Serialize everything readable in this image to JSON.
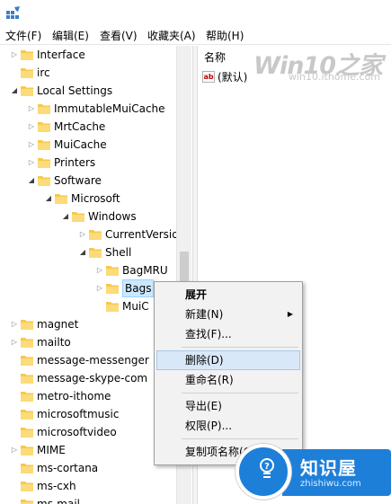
{
  "menubar": {
    "items": [
      "文件(F)",
      "编辑(E)",
      "查看(V)",
      "收藏夹(A)",
      "帮助(H)"
    ]
  },
  "tree": {
    "rows": [
      {
        "label": "Interface",
        "expander": "collapsed"
      },
      {
        "label": "irc",
        "expander": "none"
      },
      {
        "label": "Local Settings",
        "expander": "expanded"
      },
      {
        "label": "ImmutableMuiCache",
        "expander": "collapsed"
      },
      {
        "label": "MrtCache",
        "expander": "collapsed"
      },
      {
        "label": "MuiCache",
        "expander": "collapsed"
      },
      {
        "label": "Printers",
        "expander": "collapsed"
      },
      {
        "label": "Software",
        "expander": "expanded"
      },
      {
        "label": "Microsoft",
        "expander": "expanded"
      },
      {
        "label": "Windows",
        "expander": "expanded"
      },
      {
        "label": "CurrentVersio",
        "expander": "collapsed"
      },
      {
        "label": "Shell",
        "expander": "expanded"
      },
      {
        "label": "BagMRU",
        "expander": "collapsed"
      },
      {
        "label": "Bags",
        "expander": "collapsed",
        "selected": true
      },
      {
        "label": "MuiC",
        "expander": "none"
      },
      {
        "label": "magnet",
        "expander": "collapsed"
      },
      {
        "label": "mailto",
        "expander": "collapsed"
      },
      {
        "label": "message-messenger",
        "expander": "none"
      },
      {
        "label": "message-skype-com",
        "expander": "none"
      },
      {
        "label": "metro-ithome",
        "expander": "none"
      },
      {
        "label": "microsoftmusic",
        "expander": "none"
      },
      {
        "label": "microsoftvideo",
        "expander": "none"
      },
      {
        "label": "MIME",
        "expander": "collapsed"
      },
      {
        "label": "ms-cortana",
        "expander": "none"
      },
      {
        "label": "ms-cxh",
        "expander": "none"
      },
      {
        "label": "ms-mail",
        "expander": "none"
      }
    ]
  },
  "values": {
    "column_name": "名称",
    "rows": [
      {
        "name": "(默认)",
        "type_icon": "ab-string-icon"
      }
    ]
  },
  "watermark": {
    "title": "Win10之家",
    "url": "win10.ithome.com"
  },
  "context_menu": {
    "items": [
      {
        "label": "展开",
        "bold": true
      },
      {
        "label": "新建(N)",
        "submenu": true
      },
      {
        "label": "查找(F)..."
      },
      {
        "separator": true
      },
      {
        "label": "删除(D)",
        "hover": true
      },
      {
        "label": "重命名(R)"
      },
      {
        "separator": true
      },
      {
        "label": "导出(E)"
      },
      {
        "label": "权限(P)..."
      },
      {
        "separator": true
      },
      {
        "label": "复制项名称(C)"
      }
    ]
  },
  "badge": {
    "title": "知识屋",
    "url": "zhishiwu.com"
  },
  "colors": {
    "accent": "#1e7fd8",
    "selection": "#cce8ff",
    "menu_hover": "#d9e8f8",
    "folder": "#f5c94c"
  }
}
